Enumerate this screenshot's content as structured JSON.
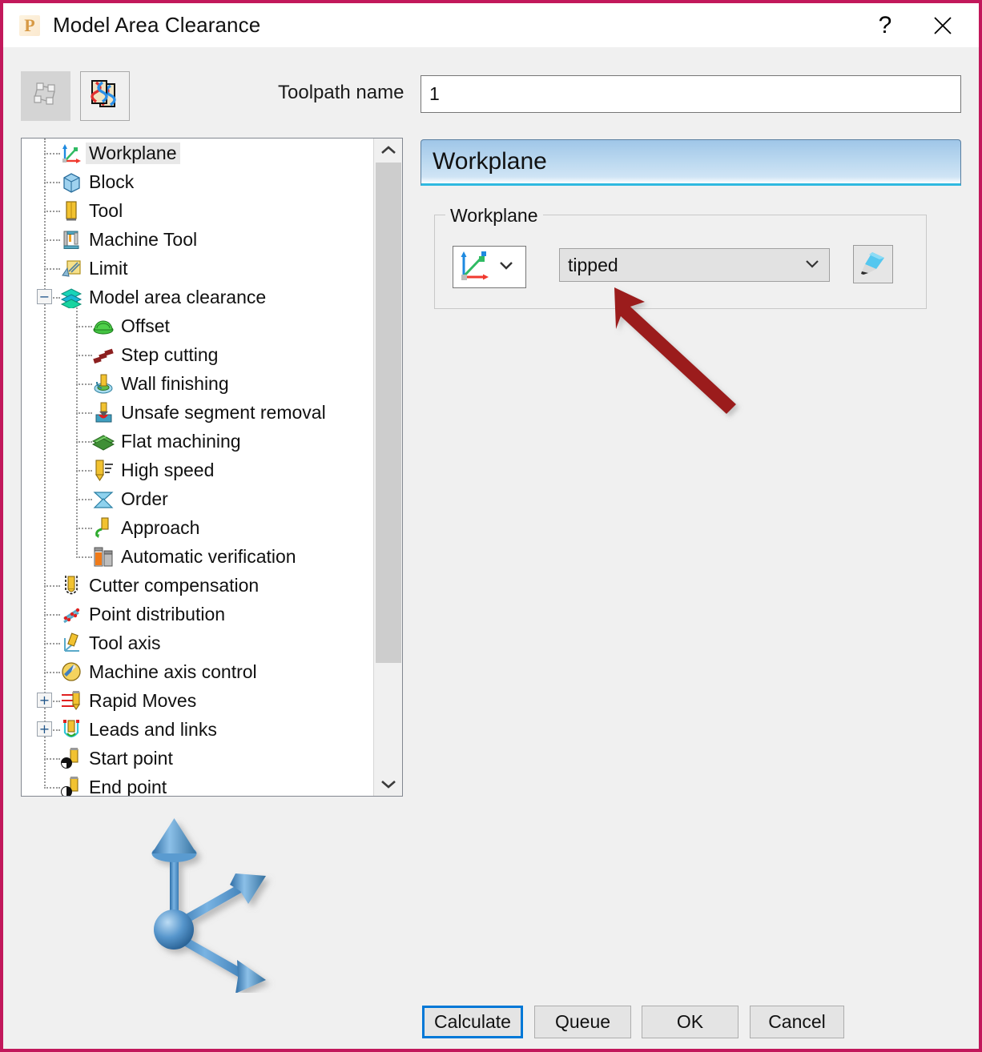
{
  "window": {
    "title": "Model Area Clearance",
    "app_icon": "P",
    "help_label": "?",
    "close_label": "close-icon",
    "border_color": "#c2185b"
  },
  "toolbar": {
    "buttons": [
      {
        "name": "simulate-toolpath-button",
        "icon": "recycle-blocks-icon",
        "enabled": false
      },
      {
        "name": "toolpath-preview-button",
        "icon": "toolpath-preview-icon",
        "enabled": true
      }
    ],
    "toolpath_name_label": "Toolpath name",
    "toolpath_name_value": "1",
    "toolpath_name_placeholder": ""
  },
  "tree": {
    "selected": "Workplane",
    "items": [
      {
        "label": "Workplane",
        "icon": "workplane-axes-icon",
        "depth": 0,
        "expander": "",
        "selected": true
      },
      {
        "label": "Block",
        "icon": "block-cube-icon",
        "depth": 0,
        "expander": ""
      },
      {
        "label": "Tool",
        "icon": "tool-icon",
        "depth": 0,
        "expander": ""
      },
      {
        "label": "Machine Tool",
        "icon": "machine-tool-icon",
        "depth": 0,
        "expander": ""
      },
      {
        "label": "Limit",
        "icon": "limit-icon",
        "depth": 0,
        "expander": ""
      },
      {
        "label": "Model area clearance",
        "icon": "model-area-clearance-icon",
        "depth": 0,
        "expander": "-"
      },
      {
        "label": "Offset",
        "icon": "offset-icon",
        "depth": 1,
        "expander": ""
      },
      {
        "label": "Step cutting",
        "icon": "step-cutting-icon",
        "depth": 1,
        "expander": ""
      },
      {
        "label": "Wall finishing",
        "icon": "wall-finishing-icon",
        "depth": 1,
        "expander": ""
      },
      {
        "label": "Unsafe segment removal",
        "icon": "unsafe-segment-removal-icon",
        "depth": 1,
        "expander": ""
      },
      {
        "label": "Flat machining",
        "icon": "flat-machining-icon",
        "depth": 1,
        "expander": ""
      },
      {
        "label": "High speed",
        "icon": "high-speed-icon",
        "depth": 1,
        "expander": ""
      },
      {
        "label": "Order",
        "icon": "order-icon",
        "depth": 1,
        "expander": ""
      },
      {
        "label": "Approach",
        "icon": "approach-icon",
        "depth": 1,
        "expander": ""
      },
      {
        "label": "Automatic verification",
        "icon": "automatic-verification-icon",
        "depth": 1,
        "expander": ""
      },
      {
        "label": "Cutter compensation",
        "icon": "cutter-compensation-icon",
        "depth": 0,
        "expander": ""
      },
      {
        "label": "Point distribution",
        "icon": "point-distribution-icon",
        "depth": 0,
        "expander": ""
      },
      {
        "label": "Tool axis",
        "icon": "tool-axis-icon",
        "depth": 0,
        "expander": ""
      },
      {
        "label": "Machine axis control",
        "icon": "machine-axis-control-icon",
        "depth": 0,
        "expander": ""
      },
      {
        "label": "Rapid Moves",
        "icon": "rapid-moves-icon",
        "depth": 0,
        "expander": "+"
      },
      {
        "label": "Leads and links",
        "icon": "leads-and-links-icon",
        "depth": 0,
        "expander": "+"
      },
      {
        "label": "Start point",
        "icon": "start-point-icon",
        "depth": 0,
        "expander": ""
      },
      {
        "label": "End point",
        "icon": "end-point-icon",
        "depth": 0,
        "expander": ""
      }
    ],
    "scrollbar": {
      "up_arrow": "chevron-up-icon",
      "down_arrow": "chevron-down-icon"
    }
  },
  "page": {
    "header_title": "Workplane",
    "group_legend": "Workplane",
    "workplane_picker_icon": "workplane-axes-icon",
    "workplane_picker_caret": "chevron-down-icon",
    "workplane_value": "tipped",
    "workplane_caret": "chevron-down-icon",
    "edit_button_icon": "pencil-icon"
  },
  "annotation": {
    "arrow_color": "#9b1c1c",
    "points_at": "workplane-combo"
  },
  "graphic": {
    "name": "3d-axis-tripod",
    "color": "#4a8fd0"
  },
  "footer": {
    "calculate_label": "Calculate",
    "queue_label": "Queue",
    "ok_label": "OK",
    "cancel_label": "Cancel",
    "focus_color": "#0078d7"
  }
}
